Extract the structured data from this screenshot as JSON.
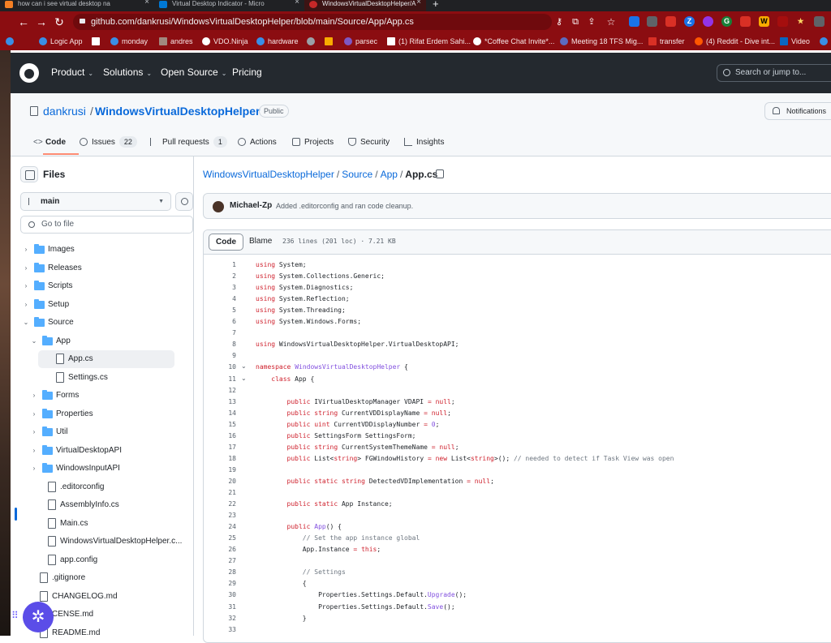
{
  "browser": {
    "tabs": [
      {
        "title": "how can i see virtual desktop na",
        "favicon_color": "#f48024",
        "active": false
      },
      {
        "title": "Virtual Desktop Indicator - Micro",
        "favicon_color": "#0078d4",
        "active": false
      },
      {
        "title": "WindowsVirtualDesktopHelper/A",
        "favicon_color": "#24292f",
        "active": true
      }
    ],
    "new_tab_label": "+",
    "url": "github.com/dankrusi/WindowsVirtualDesktopHelper/blob/main/Source/App/App.cs",
    "theme_color": "#8b0d11"
  },
  "bookmarks": [
    {
      "label": "Logic App"
    },
    {
      "label": "monday"
    },
    {
      "label": "andres"
    },
    {
      "label": "VDO.Ninja"
    },
    {
      "label": "hardware"
    },
    {
      "label": "parsec"
    },
    {
      "label": "(1) Rifat Erdem Sahi..."
    },
    {
      "label": "*Coffee Chat Invite*..."
    },
    {
      "label": "Meeting 18 TFS Mig..."
    },
    {
      "label": "transfer"
    },
    {
      "label": "(4) Reddit - Dive int..."
    },
    {
      "label": "Video"
    }
  ],
  "github": {
    "nav": [
      "Product",
      "Solutions",
      "Open Source",
      "Pricing"
    ],
    "search_placeholder": "Search or jump to...",
    "repo_owner": "dankrusi",
    "repo_separator": "/",
    "repo_name": "WindowsVirtualDesktopHelper",
    "visibility": "Public",
    "notifications_label": "Notifications",
    "tabs": [
      {
        "label": "Code",
        "count": ""
      },
      {
        "label": "Issues",
        "count": "22"
      },
      {
        "label": "Pull requests",
        "count": "1"
      },
      {
        "label": "Actions",
        "count": ""
      },
      {
        "label": "Projects",
        "count": ""
      },
      {
        "label": "Security",
        "count": ""
      },
      {
        "label": "Insights",
        "count": ""
      }
    ]
  },
  "sidebar": {
    "title": "Files",
    "branch": "main",
    "go_to_file_placeholder": "Go to file",
    "tree": [
      {
        "label": "Images",
        "type": "folder",
        "expanded": false
      },
      {
        "label": "Releases",
        "type": "folder",
        "expanded": false
      },
      {
        "label": "Scripts",
        "type": "folder",
        "expanded": false
      },
      {
        "label": "Setup",
        "type": "folder",
        "expanded": false
      },
      {
        "label": "Source",
        "type": "folder",
        "expanded": true
      },
      {
        "label": "App",
        "type": "folder",
        "expanded": true
      },
      {
        "label": "App.cs",
        "type": "file",
        "selected": true
      },
      {
        "label": "Settings.cs",
        "type": "file"
      },
      {
        "label": "Forms",
        "type": "folder",
        "expanded": false
      },
      {
        "label": "Properties",
        "type": "folder",
        "expanded": false
      },
      {
        "label": "Util",
        "type": "folder",
        "expanded": false
      },
      {
        "label": "VirtualDesktopAPI",
        "type": "folder",
        "expanded": false
      },
      {
        "label": "WindowsInputAPI",
        "type": "folder",
        "expanded": false
      },
      {
        "label": ".editorconfig",
        "type": "file"
      },
      {
        "label": "AssemblyInfo.cs",
        "type": "file"
      },
      {
        "label": "Main.cs",
        "type": "file"
      },
      {
        "label": "WindowsVirtualDesktopHelper.c...",
        "type": "file"
      },
      {
        "label": "app.config",
        "type": "file"
      },
      {
        "label": ".gitignore",
        "type": "file"
      },
      {
        "label": "CHANGELOG.md",
        "type": "file"
      },
      {
        "label": "CENSE.md",
        "type": "file"
      },
      {
        "label": "README.md",
        "type": "file"
      }
    ]
  },
  "breadcrumb": {
    "parts": [
      "WindowsVirtualDesktopHelper",
      "Source",
      "App"
    ],
    "separator": "/",
    "current": "App.cs"
  },
  "commit": {
    "author": "Michael-Zp",
    "message": "Added .editorconfig and ran code cleanup."
  },
  "code_view": {
    "tab_code": "Code",
    "tab_blame": "Blame",
    "file_info": "236 lines (201 loc) · 7.21 KB",
    "lines": [
      "using System;",
      "using System.Collections.Generic;",
      "using System.Diagnostics;",
      "using System.Reflection;",
      "using System.Threading;",
      "using System.Windows.Forms;",
      "",
      "using WindowsVirtualDesktopHelper.VirtualDesktopAPI;",
      "",
      "namespace WindowsVirtualDesktopHelper {",
      "    class App {",
      "",
      "        public IVirtualDesktopManager VDAPI = null;",
      "        public string CurrentVDDisplayName = null;",
      "        public uint CurrentVDDisplayNumber = 0;",
      "        public SettingsForm SettingsForm;",
      "        public string CurrentSystemThemeName = null;",
      "        public List<string> FGWindowHistory = new List<string>(); // needed to detect if Task View was open",
      "",
      "        public static string DetectedVDImplementation = null;",
      "",
      "        public static App Instance;",
      "",
      "        public App() {",
      "            // Set the app instance global",
      "            App.Instance = this;",
      "",
      "            // Settings",
      "            {",
      "                Properties.Settings.Default.Upgrade();",
      "                Properties.Settings.Default.Save();",
      "            }",
      ""
    ]
  },
  "fab_icon": "gear-icon"
}
